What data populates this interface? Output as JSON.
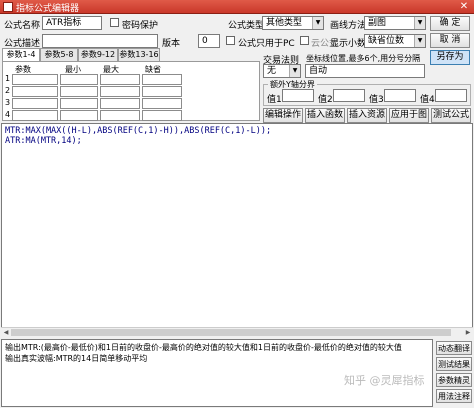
{
  "window": {
    "title": "指标公式编辑器",
    "close_glyph": "✕"
  },
  "form": {
    "name_label": "公式名称",
    "name_value": "ATR指标",
    "password_label": "密码保护",
    "desc_label": "公式描述",
    "desc_value": "",
    "version_label": "版本",
    "version_value": "0",
    "type_label": "公式类型",
    "type_value": "其他类型",
    "draw_label": "画线方法",
    "draw_value": "副图",
    "pc_only_label": "公式只用于PC",
    "cloud_label": "云公式",
    "decimals_label": "显示小数",
    "decimals_value": "缺省位数"
  },
  "buttons": {
    "ok": "确 定",
    "cancel": "取 消",
    "save_as": "另存为",
    "edit_ops": "编辑操作",
    "insert_func": "插入函数",
    "insert_res": "插入资源",
    "apply_chart": "应用于图",
    "test": "测试公式",
    "translate": "动态翻译",
    "test_result": "测试结果",
    "param_wizard": "参数精灵",
    "usage_notes": "用法注释"
  },
  "tabs": [
    "参数1-4",
    "参数5-8",
    "参数9-12",
    "参数13-16"
  ],
  "params": {
    "headers": [
      "参数",
      "最小",
      "最大",
      "缺省"
    ],
    "rows": [
      "1",
      "2",
      "3",
      "4"
    ]
  },
  "trade": {
    "label": "交易法则",
    "value": "无"
  },
  "axis": {
    "label": "坐标线位置,最多6个,用分号分隔",
    "value": "自动",
    "extra_legend": "额外Y轴分界",
    "values": [
      "值1",
      "值2",
      "值3",
      "值4"
    ]
  },
  "editor": {
    "lines": [
      "MTR:MAX(MAX((H-L),ABS(REF(C,1)-H)),ABS(REF(C,1)-L));",
      "ATR:MA(MTR,14);"
    ]
  },
  "output": {
    "lines": [
      "输出MTR:(最高价-最低价)和1日前的收盘价-最高价的绝对值的较大值和1日前的收盘价-最低价的绝对值的较大值",
      "输出真实波幅:MTR的14日简单移动平均"
    ]
  },
  "watermark": "知乎 @灵犀指标"
}
